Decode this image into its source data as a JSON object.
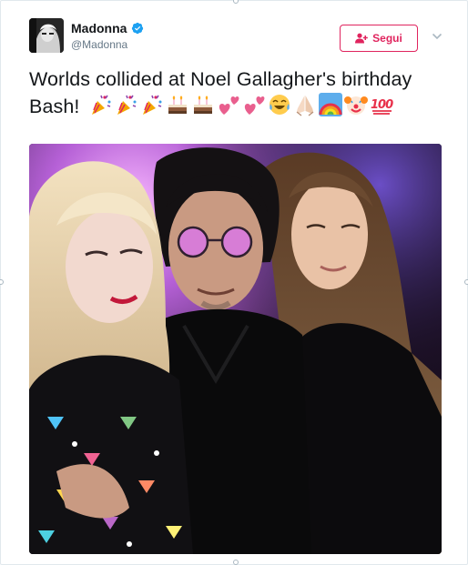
{
  "author": {
    "name": "Madonna",
    "handle": "@Madonna",
    "verified": true
  },
  "follow_button": {
    "label": "Segui",
    "icon": "person-add-icon"
  },
  "menu_icon": "chevron-down-icon",
  "tweet": {
    "text": "Worlds collided at Noel Gallagher's birthday Bash!",
    "emojis": [
      "party-popper",
      "party-popper",
      "party-popper",
      "birthday-cake",
      "birthday-cake",
      "two-hearts",
      "two-hearts",
      "tears-of-joy",
      "folded-hands",
      "rainbow",
      "clown-face",
      "hundred-points"
    ]
  },
  "photo": {
    "description_icon": "group-photo"
  },
  "colors": {
    "accent": "#e0245e",
    "verified": "#1da1f2",
    "text": "#14171a",
    "muted": "#657786"
  }
}
